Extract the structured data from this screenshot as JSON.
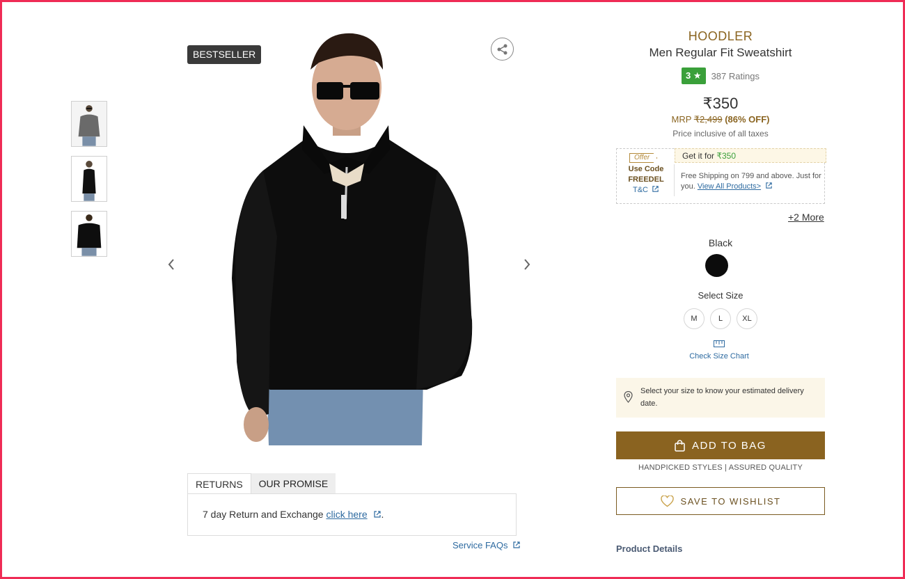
{
  "gallery": {
    "badge": "BESTSELLER",
    "thumbnails": [
      "front-grey",
      "side-black",
      "back-black"
    ]
  },
  "tabs": [
    {
      "label": "RETURNS",
      "active": true
    },
    {
      "label": "OUR PROMISE",
      "active": false
    }
  ],
  "returns": {
    "text": "7 day Return and Exchange ",
    "link": "click here",
    "suffix": "."
  },
  "service_faqs": "Service FAQs",
  "product": {
    "brand": "HOODLER",
    "name": "Men Regular Fit Sweatshirt",
    "rating": "3",
    "rating_star": "★",
    "ratings_count": "387 Ratings",
    "price": "₹350",
    "mrp_label": "MRP ",
    "mrp": "₹2,499",
    "discount": "(86% OFF)",
    "tax_note": "Price inclusive of all taxes"
  },
  "offer": {
    "tag": "Offer",
    "use_code": "Use Code",
    "code": "FREEDEL",
    "tc": "T&C",
    "get_it_for": "Get it for ",
    "get_it_price": "₹350",
    "description": "Free Shipping on 799 and above. Just for you. ",
    "view_all": "View All Products>",
    "more": "+2 More"
  },
  "color": {
    "label": "Black",
    "swatch": "#0c0c0c"
  },
  "size": {
    "label": "Select Size",
    "options": [
      "M",
      "L",
      "XL"
    ],
    "chart_link": "Check Size Chart"
  },
  "delivery": {
    "text": "Select your size to know your estimated delivery date."
  },
  "actions": {
    "add_to_bag": "ADD TO BAG",
    "tagline": "HANDPICKED STYLES | ASSURED QUALITY",
    "wishlist": "SAVE TO WISHLIST"
  },
  "details_heading": "Product Details",
  "colors": {
    "brand": "#8a6320",
    "rating_green": "#3aa03a",
    "link_blue": "#2d6aa0",
    "frame": "#ef2b55"
  }
}
